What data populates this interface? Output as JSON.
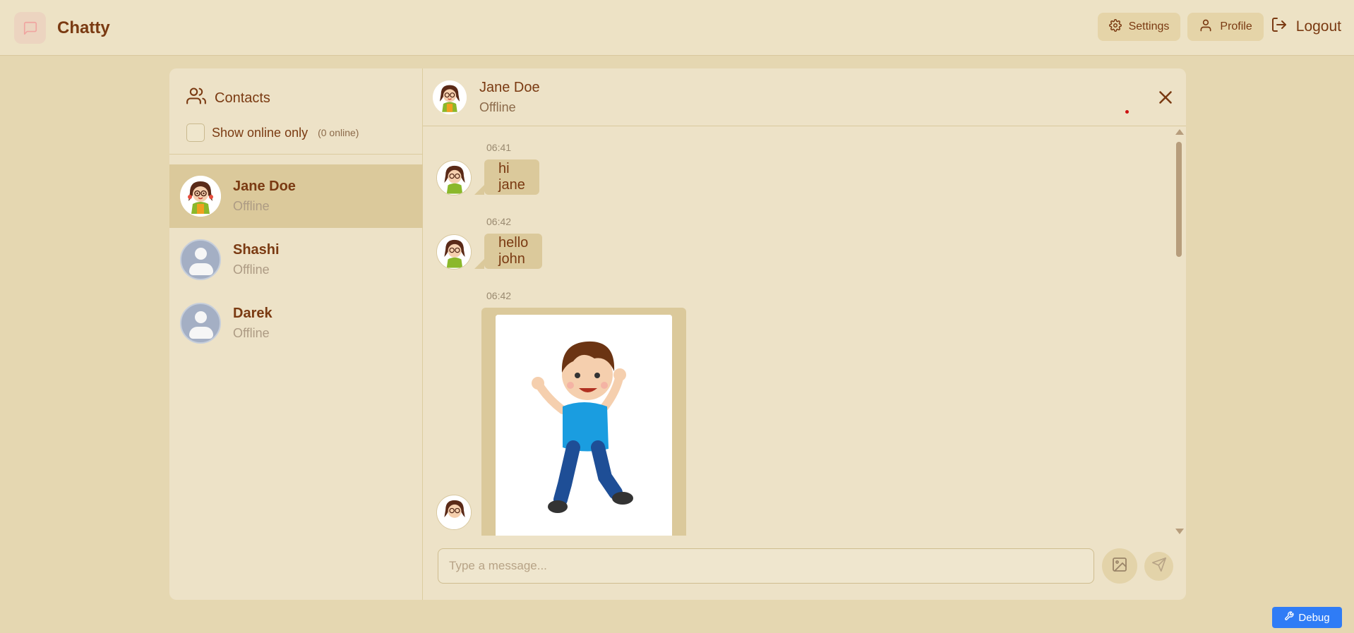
{
  "app": {
    "name": "Chatty",
    "logo_icon": "message-square-icon",
    "accent_color": "#7a3a12",
    "background_color": "#e5d7b1"
  },
  "nav": {
    "settings_label": "Settings",
    "profile_label": "Profile",
    "logout_label": "Logout"
  },
  "sidebar": {
    "title": "Contacts",
    "filter_label": "Show online only",
    "online_count": "(0 online)",
    "contacts": [
      {
        "name": "Jane Doe",
        "status": "Offline",
        "avatar": "cartoon-girl",
        "selected": true
      },
      {
        "name": "Shashi",
        "status": "Offline",
        "avatar": "default-user",
        "selected": false
      },
      {
        "name": "Darek",
        "status": "Offline",
        "avatar": "default-user",
        "selected": false
      }
    ]
  },
  "chat": {
    "name": "Jane Doe",
    "status": "Offline",
    "messages": [
      {
        "time": "06:41",
        "text": "hi jane",
        "type": "text"
      },
      {
        "time": "06:42",
        "text": "hello john",
        "type": "text"
      },
      {
        "time": "06:42",
        "text": "",
        "type": "image",
        "image": "cartoon-boy-jumping"
      }
    ],
    "input_placeholder": "Type a message..."
  },
  "debug": {
    "label": "Debug"
  }
}
